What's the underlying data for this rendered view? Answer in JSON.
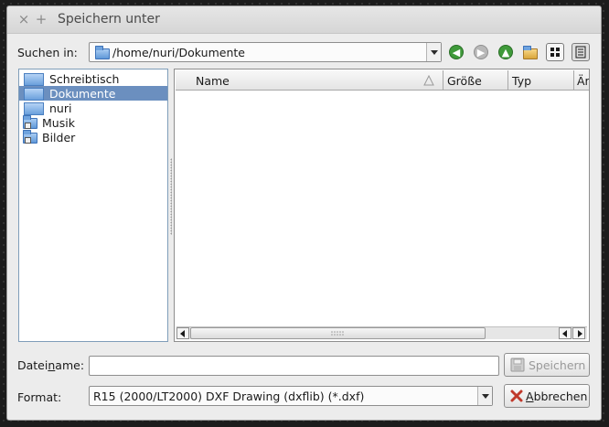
{
  "window": {
    "title": "Speichern unter",
    "close_glyph": "×",
    "maximize_glyph": "+"
  },
  "location": {
    "label": "Suchen in:",
    "path": "/home/nuri/Dokumente"
  },
  "toolbar": {
    "icons": [
      "back-icon",
      "forward-icon",
      "parent-folder-icon",
      "new-folder-icon",
      "icon-view-icon",
      "detail-view-icon"
    ]
  },
  "sidebar": {
    "items": [
      {
        "label": "Schreibtisch",
        "selected": false
      },
      {
        "label": "Dokumente",
        "selected": true
      },
      {
        "label": "nuri",
        "selected": false
      },
      {
        "label": "Musik",
        "selected": false
      },
      {
        "label": "Bilder",
        "selected": false
      }
    ]
  },
  "filelist": {
    "columns": [
      "Name",
      "Größe",
      "Typ",
      "Är"
    ],
    "rows": []
  },
  "filename": {
    "label_pre": "Datei",
    "label_mnemonic": "n",
    "label_post": "ame:",
    "value": ""
  },
  "format": {
    "label": "Format:",
    "value": "R15 (2000/LT2000) DXF Drawing (dxflib) (*.dxf)"
  },
  "buttons": {
    "save": "Speichern",
    "cancel_mnemonic": "A",
    "cancel_rest": "bbrechen"
  },
  "colors": {
    "selection": "#6b8fbf",
    "nav_green": "#3f9a3a",
    "nav_disabled": "#b8b8b8",
    "folder_blue": "#5f98d8"
  }
}
